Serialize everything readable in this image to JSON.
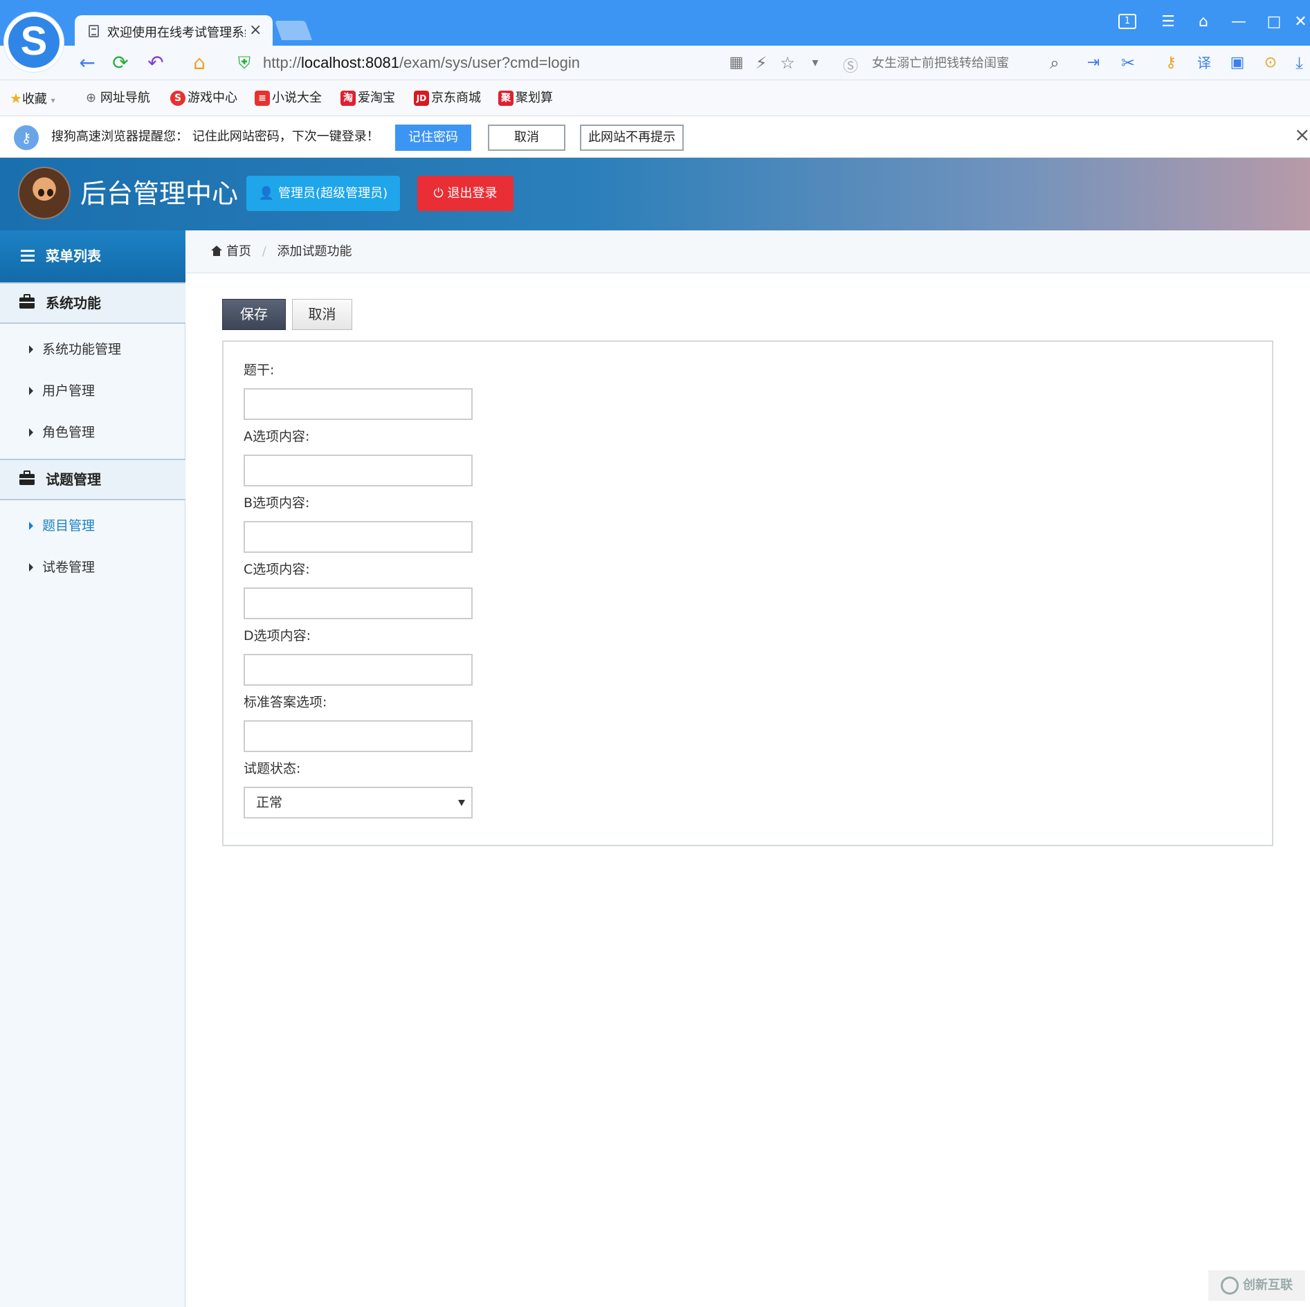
{
  "browser": {
    "tab_title": "欢迎使用在线考试管理系统",
    "tab_close": "×",
    "url_prefix": "http://",
    "url_host": "localhost:8081",
    "url_path": "/exam/sys/user?cmd=login",
    "search_placeholder": "女生溺亡前把钱转给闺蜜",
    "window_number": "1"
  },
  "bookmarks": [
    {
      "label": "收藏"
    },
    {
      "label": "网址导航"
    },
    {
      "label": "游戏中心"
    },
    {
      "label": "小说大全"
    },
    {
      "label": "爱淘宝",
      "icon_text": "淘"
    },
    {
      "label": "京东商城",
      "icon_text": "JD"
    },
    {
      "label": "聚划算",
      "icon_text": "聚"
    }
  ],
  "password_bar": {
    "message": "搜狗高速浏览器提醒您：  记住此网站密码，下次一键登录！",
    "remember": "记住密码",
    "cancel": "取消",
    "never": "此网站不再提示",
    "close": "×"
  },
  "header": {
    "title": "后台管理中心",
    "admin_label": "管理员(超级管理员)",
    "logout_label": "退出登录"
  },
  "sidebar": {
    "menu_title": "菜单列表",
    "groups": [
      {
        "label": "系统功能",
        "items": [
          {
            "label": "系统功能管理"
          },
          {
            "label": "用户管理"
          },
          {
            "label": "角色管理"
          }
        ]
      },
      {
        "label": "试题管理",
        "items": [
          {
            "label": "题目管理"
          },
          {
            "label": "试卷管理"
          }
        ]
      }
    ]
  },
  "breadcrumb": {
    "home": "首页",
    "sep": "/",
    "current": "添加试题功能"
  },
  "toolbar": {
    "save": "保存",
    "cancel": "取消"
  },
  "form": {
    "fields": [
      {
        "label": "题干:",
        "value": ""
      },
      {
        "label": "A选项内容:",
        "value": ""
      },
      {
        "label": "B选项内容:",
        "value": ""
      },
      {
        "label": "C选项内容:",
        "value": ""
      },
      {
        "label": "D选项内容:",
        "value": ""
      },
      {
        "label": "标准答案选项:",
        "value": ""
      }
    ],
    "status_label": "试题状态:",
    "status_value": "正常"
  },
  "watermark": "创新互联",
  "colors": {
    "accent": "#3c95f3",
    "sidebar_active": "#1a82c4",
    "logout": "#ea2e35",
    "admin": "#1ea5ea"
  }
}
